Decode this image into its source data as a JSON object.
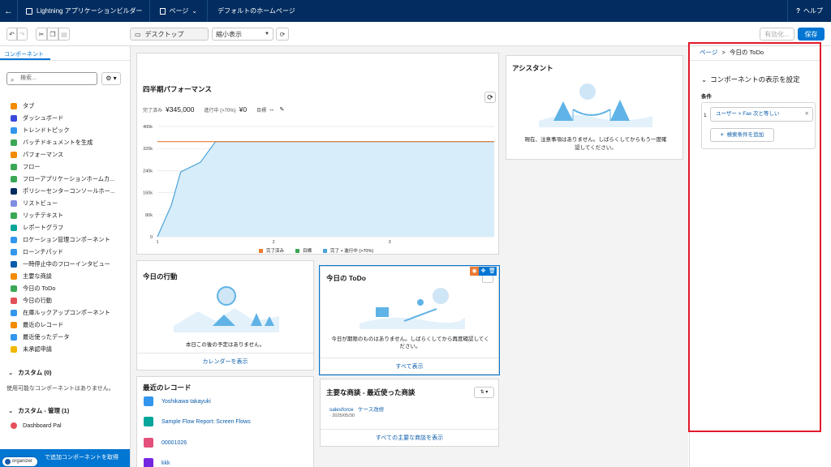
{
  "topbar": {
    "back_icon": "back-arrow-icon",
    "app_title": "Lightning アプリケーションビルダー",
    "page_menu": "ページ",
    "page_name": "デフォルトのホームページ",
    "help": "ヘルプ"
  },
  "toolbar": {
    "device": "デスクトップ",
    "view": "縮小表示",
    "activate": "有効化...",
    "save": "保存"
  },
  "left": {
    "tab": "コンポーネント",
    "search_placeholder": "検索...",
    "components": [
      {
        "label": "タブ",
        "color": "#f28b00"
      },
      {
        "label": "ダッシュボード",
        "color": "#3a49da"
      },
      {
        "label": "トレンドトピック",
        "color": "#3296ed"
      },
      {
        "label": "バッチドキュメントを生成",
        "color": "#3ba755"
      },
      {
        "label": "パフォーマンス",
        "color": "#f28b00"
      },
      {
        "label": "フロー",
        "color": "#3ba755"
      },
      {
        "label": "フローアプリケーションホームカ...",
        "color": "#3ba755"
      },
      {
        "label": "ポリシーセンターコンソールホー...",
        "color": "#032d60"
      },
      {
        "label": "リストビュー",
        "color": "#7f8de1"
      },
      {
        "label": "リッチテキスト",
        "color": "#3ba755"
      },
      {
        "label": "レポートグラフ",
        "color": "#06a59a"
      },
      {
        "label": "ロケーション管理コンポーネント",
        "color": "#3296ed"
      },
      {
        "label": "ローンチパッド",
        "color": "#3296ed"
      },
      {
        "label": "一時停止中のフローインタビュー",
        "color": "#0b5cab"
      },
      {
        "label": "主要な商談",
        "color": "#f28b00"
      },
      {
        "label": "今日の ToDo",
        "color": "#3ba755"
      },
      {
        "label": "今日の行動",
        "color": "#e4505a"
      },
      {
        "label": "在庫ルックアップコンポーネント",
        "color": "#3296ed"
      },
      {
        "label": "最近のレコード",
        "color": "#f28b00"
      },
      {
        "label": "最近使ったデータ",
        "color": "#3296ed"
      },
      {
        "label": "未承認申請",
        "color": "#f2b800"
      }
    ],
    "custom_section": "カスタム (0)",
    "custom_note": "使用可能なコンポーネントはありません。",
    "managed_section": "カスタム - 管理 (1)",
    "managed_item": "Dashboard Pal",
    "appexchange_text": "で追加コンポーネントを取得",
    "organizer": "organizer"
  },
  "cards": {
    "performance": {
      "title": "四半期パフォーマンス",
      "closed_label": "完了済み",
      "closed_value": "¥345,000",
      "open_label": "進行中 (>70%)",
      "open_value": "¥0",
      "goal_label": "目標",
      "goal_value": "--"
    },
    "assistant": {
      "title": "アシスタント",
      "message": "現在、注意事項はありません。しばらくしてからもう一度確認してください。"
    },
    "events": {
      "title": "今日の行動",
      "message": "本日この後の予定はありません。",
      "footer": "カレンダーを表示"
    },
    "todo": {
      "title": "今日の ToDo",
      "message": "今日が期限のものはありません。しばらくしてから再度確認してください。",
      "footer": "すべて表示"
    },
    "recent": {
      "title": "最近のレコード",
      "items": [
        {
          "label": "Yoshikawa takayuki",
          "color": "#3296ed"
        },
        {
          "label": "Sample Flow Report: Screen Flows",
          "color": "#06a59a"
        },
        {
          "label": "00001026",
          "color": "#e4507a"
        },
        {
          "label": "kkk",
          "color": "#7526e3"
        }
      ]
    },
    "deals": {
      "title": "主要な商談 - 最近使った商談",
      "account": "salesforce",
      "opportunity": "ケース改修",
      "date": "· 2025/05/30",
      "footer": "すべての主要な商談を表示"
    }
  },
  "chart_data": {
    "type": "line",
    "title": "",
    "x_ticks": [
      "1",
      "2",
      "3"
    ],
    "y_ticks": [
      "0",
      "80k",
      "160k",
      "240k",
      "320k",
      "400k"
    ],
    "ylim": [
      0,
      400000
    ],
    "xlim": [
      1,
      3.9
    ],
    "legend": [
      "完了済み",
      "目標",
      "完了 + 進行中 (>70%)"
    ],
    "legend_colors": [
      "#ea7a32",
      "#3ba755",
      "#4ba3d9"
    ],
    "series": [
      {
        "name": "完了済み",
        "x": [
          1,
          3.9
        ],
        "y": [
          345000,
          345000
        ]
      },
      {
        "name": "完了 + 進行中 (>70%)",
        "x": [
          1,
          1.12,
          1.2,
          1.37,
          1.5,
          1.6,
          3.9
        ],
        "y": [
          0,
          115000,
          235000,
          270000,
          345000,
          345000,
          345000
        ]
      }
    ]
  },
  "right": {
    "breadcrumb_page": "ページ",
    "breadcrumb_sep": ">",
    "breadcrumb_current": "今日の ToDo",
    "section_title": "コンポーネントの表示を設定",
    "cond_label": "条件",
    "cond_num": "1",
    "filter_text": "ユーザー > Fax 次と等しい",
    "add_filter": "検索条件を追加"
  }
}
